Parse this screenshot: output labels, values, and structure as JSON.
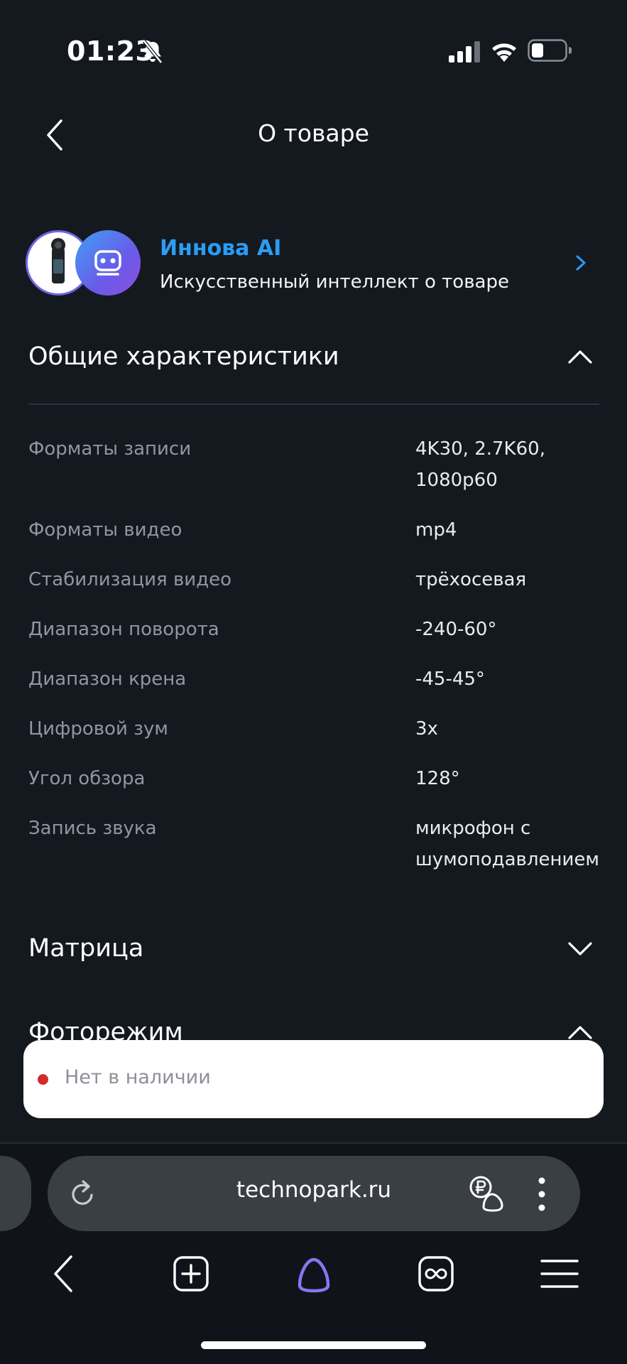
{
  "status_bar": {
    "time": "01:23"
  },
  "header": {
    "title": "О товаре"
  },
  "ai_banner": {
    "title": "Иннова AI",
    "subtitle": "Искусственный интеллект о товаре"
  },
  "sections": {
    "general": {
      "title": "Общие характеристики",
      "expanded": true
    },
    "matrix": {
      "title": "Матрица",
      "expanded": false
    },
    "photo": {
      "title": "Фоторежим",
      "expanded": true
    }
  },
  "specs": [
    {
      "label": "Форматы записи",
      "value": "4K30, 2.7K60, 1080p60"
    },
    {
      "label": "Форматы видео",
      "value": "mp4"
    },
    {
      "label": "Стабилизация видео",
      "value": "трёхосевая"
    },
    {
      "label": "Диапазон поворота",
      "value": "-240-60°"
    },
    {
      "label": "Диапазон крена",
      "value": "-45-45°"
    },
    {
      "label": "Цифровой зум",
      "value": "3x"
    },
    {
      "label": "Угол обзора",
      "value": "128°"
    },
    {
      "label": "Запись звука",
      "value": "микрофон с шумоподавлением"
    }
  ],
  "toast": {
    "text": "Нет в наличии",
    "dot_color": "#d22b2b"
  },
  "browser": {
    "url": "technopark.ru"
  },
  "colors": {
    "background": "#141920",
    "accent": "#2a9df4",
    "alice": "#8b74f0"
  }
}
